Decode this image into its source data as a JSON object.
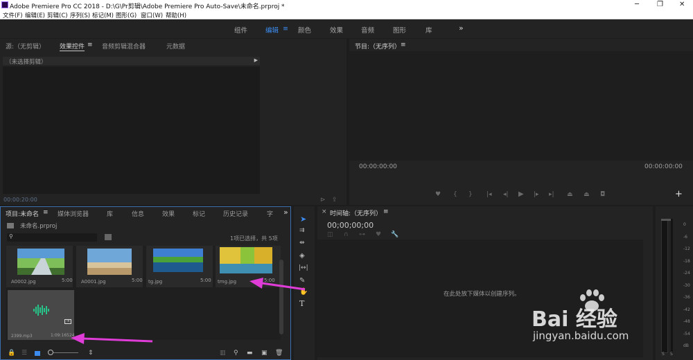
{
  "window": {
    "title": "Adobe Premiere Pro CC 2018 - D:\\G\\Pr剪辑\\Adobe Premiere Pro Auto-Save\\未命名.prproj *",
    "minimize": "─",
    "maximize": "❐",
    "close": "✕"
  },
  "menu": [
    "文件(F)",
    "编辑(E)",
    "剪辑(C)",
    "序列(S)",
    "标记(M)",
    "图形(G)",
    "窗口(W)",
    "帮助(H)"
  ],
  "workspaces": {
    "items": [
      "组件",
      "编辑",
      "颜色",
      "效果",
      "音频",
      "图形",
      "库"
    ],
    "active_index": 1,
    "menu_glyph": "≡",
    "more": "»"
  },
  "source_panel": {
    "tabs": [
      "源:（无剪辑）",
      "效果控件",
      "音频剪辑混合器",
      "元数据"
    ],
    "active_tab": 1,
    "menu_glyph": "≡",
    "no_clip": "（未选择剪辑）",
    "timecode": "00:00:20:00"
  },
  "program_panel": {
    "title": "节目:（无序列）",
    "menu_glyph": "≡",
    "timecode_left": "00:00:00:00",
    "timecode_right": "00:00:00:00",
    "add_button": "+"
  },
  "project_panel": {
    "tabs": [
      "项目:未命名",
      "媒体浏览器",
      "库",
      "信息",
      "效果",
      "标记",
      "历史记录",
      "字"
    ],
    "more": "»",
    "menu_glyph": "≡",
    "project_file": "未命名.prproj",
    "selection_status": "1项已选择，共 5项",
    "items": [
      {
        "name": "A0002.jpg",
        "duration": "5:00",
        "colors": [
          "#5a9bd6",
          "#7fbf5a",
          "#3f6e2e"
        ]
      },
      {
        "name": "A0001.jpg",
        "duration": "5:00",
        "colors": [
          "#6fa7d8",
          "#d8c49a",
          "#b89a6a"
        ]
      },
      {
        "name": "tg.jpg",
        "duration": "5:00",
        "colors": [
          "#3f7fd2",
          "#4aa13a",
          "#1e5a8e"
        ]
      },
      {
        "name": "tmg.jpg",
        "duration": "5:00",
        "colors": [
          "#e0c33a",
          "#8bc43a",
          "#3f8fb2"
        ]
      }
    ],
    "audio_item": {
      "name": "2399.mp3",
      "duration": "1:09:16524"
    }
  },
  "timeline_panel": {
    "title": "时间轴:（无序列）",
    "menu_glyph": "≡",
    "close_glyph": "×",
    "timecode": "00;00;00;00",
    "empty_message": "在此处放下媒体以创建序列。"
  },
  "meter": {
    "labels": [
      "0",
      "-6",
      "-12",
      "-18",
      "-24",
      "-30",
      "-36",
      "-42",
      "-48",
      "-54",
      "dB"
    ],
    "bottom_labels": [
      "S",
      "S"
    ]
  },
  "watermark": {
    "brand": "Bai 经验",
    "url": "jingyan.baidu.com"
  }
}
